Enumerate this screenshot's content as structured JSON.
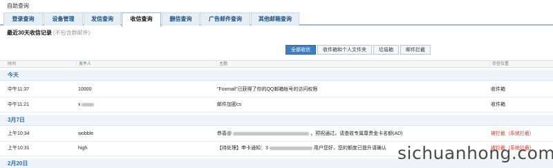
{
  "page": {
    "title": "自助查询"
  },
  "tabs": [
    {
      "label": "登录查询",
      "active": false
    },
    {
      "label": "设备管理",
      "active": false
    },
    {
      "label": "发信查询",
      "active": false
    },
    {
      "label": "收信查询",
      "active": true
    },
    {
      "label": "删信查询",
      "active": false
    },
    {
      "label": "广告邮件查询",
      "active": false
    },
    {
      "label": "其他邮箱查询",
      "active": false
    }
  ],
  "section": {
    "heading": "最近30天收信记录",
    "hint": "(不包含群邮件)"
  },
  "filters": [
    {
      "label": "全部收信",
      "active": true
    },
    {
      "label": "收件箱和个人文件夹",
      "active": false
    },
    {
      "label": "垃圾箱",
      "active": false
    },
    {
      "label": "邮件拦截",
      "active": false
    }
  ],
  "columns": {
    "time": "时间",
    "sender": "发件人",
    "subject": "主题",
    "location": "存信位置"
  },
  "groups": [
    {
      "label": "今天"
    },
    {
      "label": "3月7日"
    },
    {
      "label": "2月20日"
    }
  ],
  "rows": [
    {
      "time": "中午11:37",
      "sender": "10000",
      "subject": "\"Foxmail\"已获得了你的QQ邮箱帐号的访问权限",
      "location": "收件箱",
      "spam": false
    },
    {
      "time": "中午11:21",
      "sender": "x",
      "subject": "邮件加密cs",
      "location": "收件箱",
      "spam": false
    },
    {
      "time": "上午10:34",
      "sender": "wobble",
      "subject_prefix": "恭喜@",
      "subject_mid": "，预祝通过，请查收专属尊贵金卡名额(AD)",
      "location": "被拦截（系统拦截）",
      "spam": true
    },
    {
      "time": "上午10:31",
      "sender": "high",
      "subject_prefix": "【待处理】申卡通知：3",
      "subject_mid": "用户您好，您的额度已提升请确认",
      "location": "被拦截（系统拦截）",
      "spam": true
    }
  ],
  "watermark": "sichuanhong.com",
  "colors": {
    "accent": "#3d7fc1",
    "group_text": "#2b6db0",
    "spam": "#d23a2a"
  }
}
